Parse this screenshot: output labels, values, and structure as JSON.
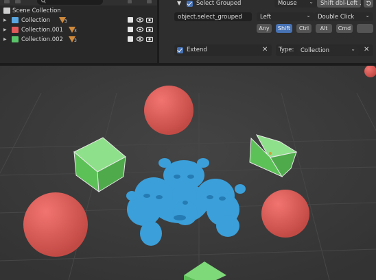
{
  "outliner": {
    "scene_label": "Scene Collection",
    "collections": [
      {
        "label": "Collection",
        "color": "#5aa7e0",
        "badge": "3"
      },
      {
        "label": "Collection.001",
        "color": "#e05a5a",
        "badge": "3"
      },
      {
        "label": "Collection.002",
        "color": "#5ac46a",
        "badge": "3"
      }
    ]
  },
  "keymap": {
    "item_name": "Select Grouped",
    "input_type": "Mouse",
    "event_summary": "Shift dbl-Left ...",
    "operator_id": "object.select_grouped",
    "button": "Left",
    "event_value": "Double Click",
    "modifiers": [
      {
        "label": "Any",
        "active": false
      },
      {
        "label": "Shift",
        "active": true
      },
      {
        "label": "Ctrl",
        "active": false
      },
      {
        "label": "Alt",
        "active": false
      },
      {
        "label": "Cmd",
        "active": false
      }
    ],
    "extend_label": "Extend",
    "type_label": "Type:",
    "type_value": "Collection"
  },
  "colors": {
    "accent": "#4772b3",
    "sphere_red": "#e05d58",
    "cube_green": "#6ccf6a",
    "monkey_blue": "#3b9fd9"
  }
}
